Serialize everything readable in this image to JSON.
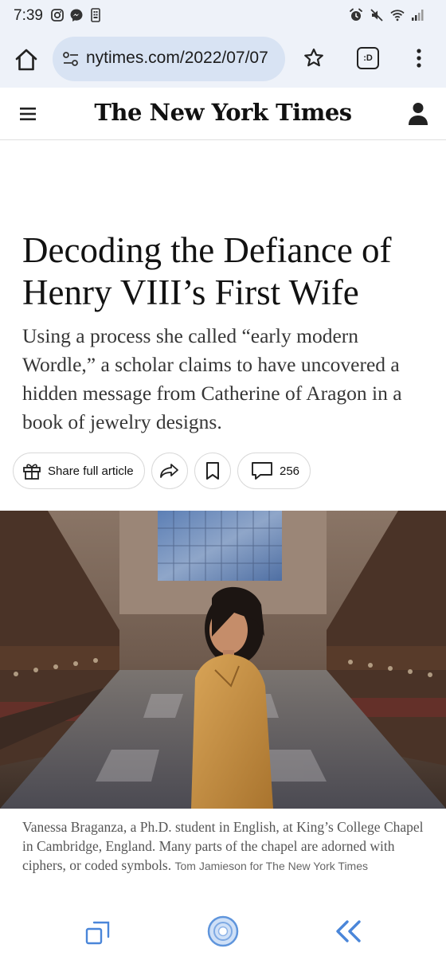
{
  "status_bar": {
    "time": "7:39",
    "left_icons": [
      "instagram-icon",
      "messenger-icon",
      "phone-app-icon"
    ],
    "right_icons": [
      "alarm-icon",
      "mute-icon",
      "wifi-icon",
      "signal-icon"
    ]
  },
  "browser": {
    "url": "nytimes.com/2022/07/07",
    "tab_button_label": ":D"
  },
  "header": {
    "logo": "The New York Times"
  },
  "article": {
    "headline": "Decoding the Defiance of Henry VIII’s First Wife",
    "summary": "Using a process she called “early modern Wordle,” a scholar claims to have uncovered a hidden message from Catherine of Aragon in a book of jewelry designs.",
    "share_label": "Share full article",
    "comment_count": "256",
    "caption": "Vanessa Braganza, a Ph.D. student in English, at King’s College Chapel in Cambridge, England. Many parts of the chapel are adorned with ciphers, or coded symbols.",
    "credit": "Tom Jamieson for The New York Times"
  },
  "colors": {
    "chrome_background": "#eef2f9",
    "url_pill": "#d8e3f3",
    "text_primary": "#121212",
    "text_summary": "#363636",
    "caption_text": "#555555",
    "toolbar_accent": "#4a86d9"
  }
}
